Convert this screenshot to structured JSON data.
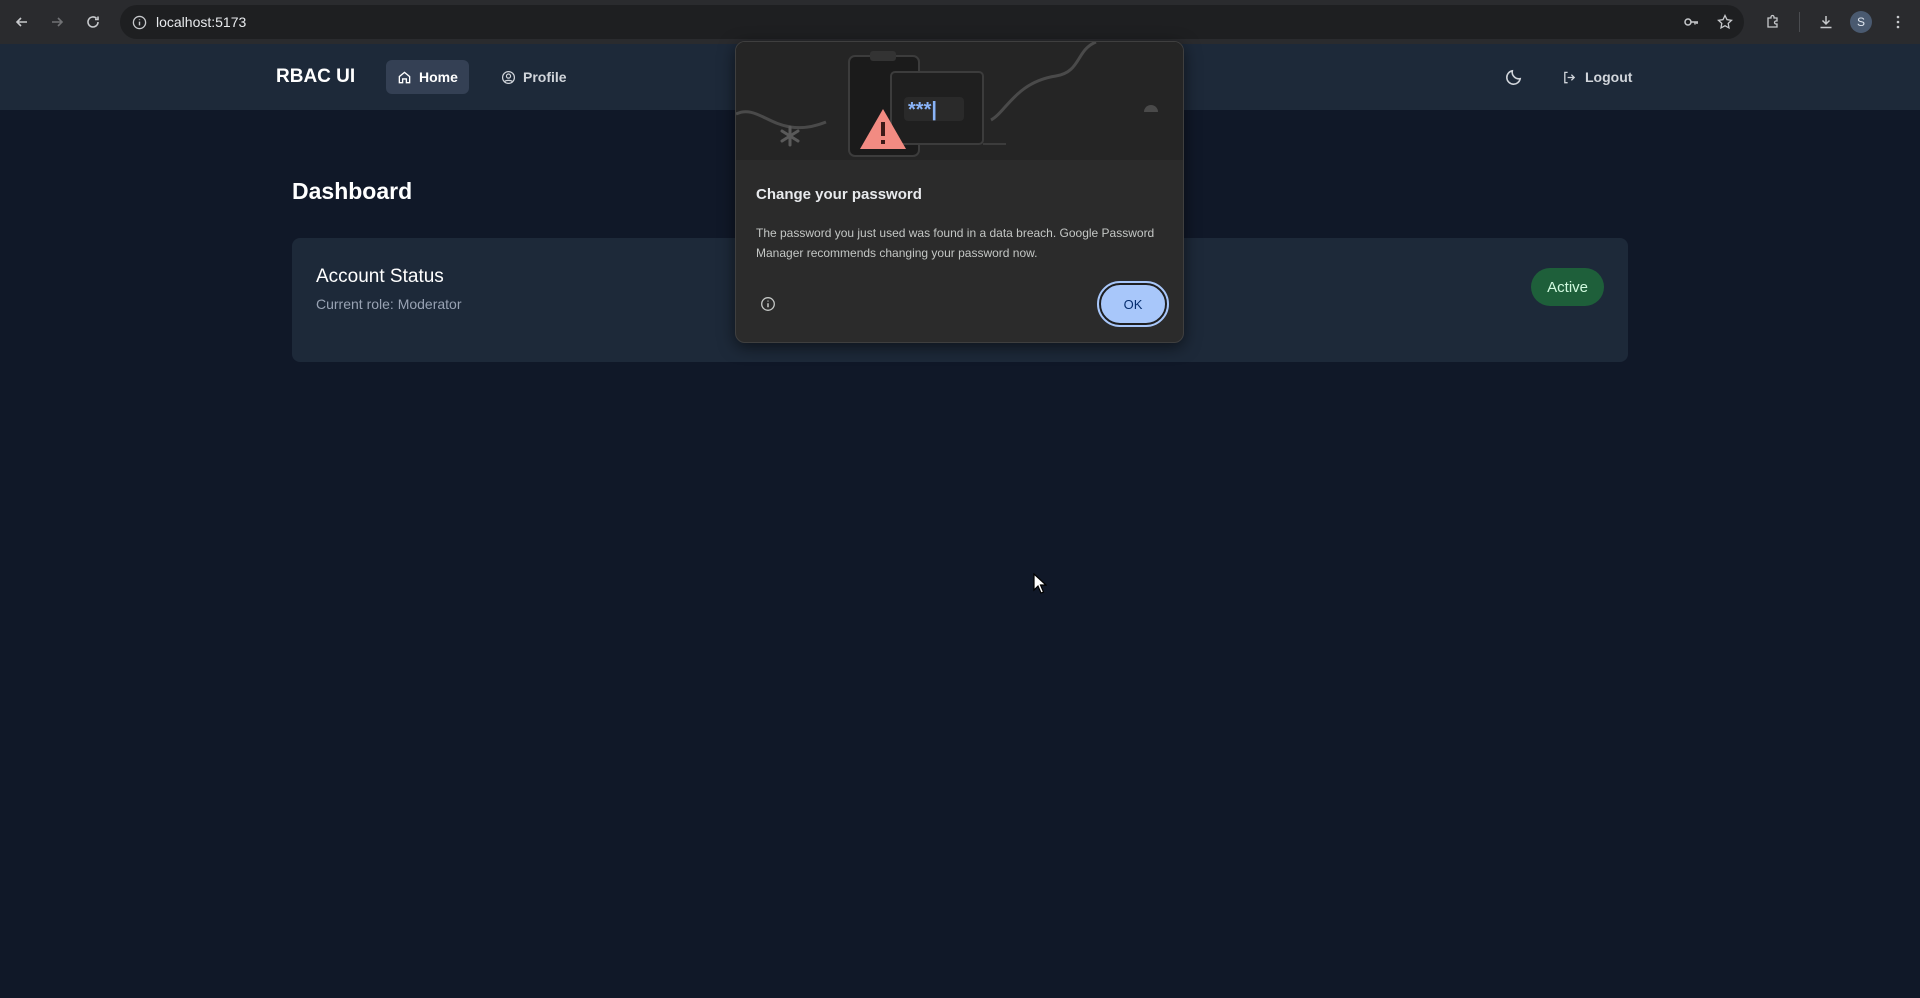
{
  "browser": {
    "url": "localhost:5173",
    "profile_initial": "S"
  },
  "navbar": {
    "brand": "RBAC UI",
    "items": [
      {
        "label": "Home",
        "active": true
      },
      {
        "label": "Profile",
        "active": false
      }
    ],
    "logout_label": "Logout"
  },
  "main": {
    "title": "Dashboard",
    "card": {
      "title": "Account Status",
      "subtitle": "Current role: Moderator",
      "status": "Active"
    }
  },
  "password_bubble": {
    "title": "Change your password",
    "body": "The password you just used was found in a data breach. Google Password Manager recommends changing your password now.",
    "ok_label": "OK",
    "illustration_text": "***|"
  },
  "colors": {
    "page_bg": "#101828",
    "navbar_bg": "#1d2939",
    "active_badge_bg": "#1e5f3a",
    "ok_button_bg": "#a8c7fa"
  },
  "icons": {
    "home": "home-icon",
    "profile": "user-circle-icon",
    "theme": "moon-icon",
    "logout": "logout-icon"
  }
}
